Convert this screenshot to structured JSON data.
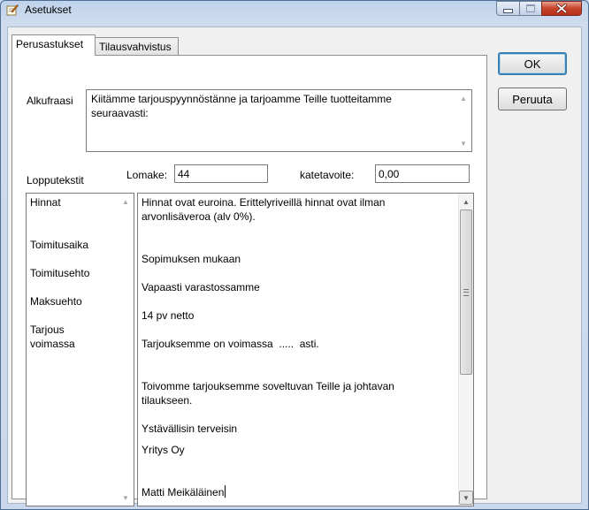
{
  "window": {
    "title": "Asetukset",
    "icon": "pencil-note-icon"
  },
  "tabs": [
    {
      "label": "Perusastukset",
      "active": true
    },
    {
      "label": "Tilausvahvistus",
      "active": false
    }
  ],
  "alkufraasi": {
    "label": "Alkufraasi",
    "lines": [
      "Kiitämme tarjouspyynnöstänne ja tarjoamme Teille tuotteitamme",
      "seuraavasti:"
    ]
  },
  "lopputekstit": {
    "label": "Lopputekstit"
  },
  "lomake": {
    "label": "Lomake:",
    "value": "44"
  },
  "katetavoite": {
    "label": "katetavoite:",
    "value": "0,00"
  },
  "left_list": [
    "Hinnat",
    "Toimitusaika",
    "Toimitusehto",
    "Maksuehto",
    "Tarjous",
    "voimassa"
  ],
  "body_lines": [
    "Hinnat ovat euroina. Erittelyriveillä hinnat ovat ilman",
    "arvonlisäveroa (alv 0%).",
    "Sopimuksen mukaan",
    "Vapaasti varastossamme",
    "14 pv netto",
    "Tarjouksemme on voimassa  .....  asti.",
    "Toivomme tarjouksemme soveltuvan Teille ja johtavan",
    "tilaukseen.",
    "Ystävällisin terveisin",
    "Yritys Oy",
    "Matti Meikäläinen"
  ],
  "buttons": {
    "ok": "OK",
    "cancel": "Peruuta"
  }
}
